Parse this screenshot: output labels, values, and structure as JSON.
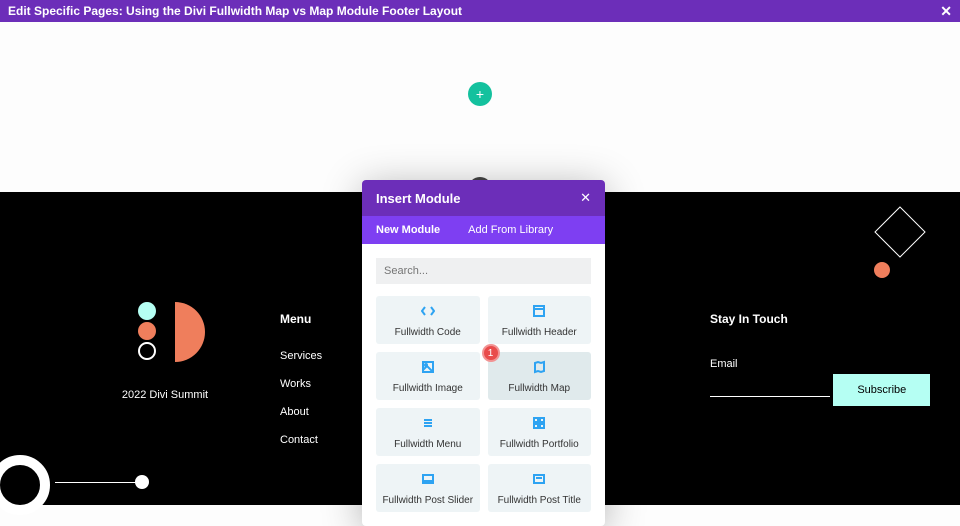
{
  "topbar": {
    "title": "Edit Specific Pages: Using the Divi Fullwidth Map vs Map Module Footer Layout"
  },
  "canvas": {
    "add_icon": "+",
    "add_icon2": "+"
  },
  "footer": {
    "brand_label": "2022 Divi Summit",
    "menu_title": "Menu",
    "menu_items": [
      "Services",
      "Works",
      "About",
      "Contact"
    ],
    "touch_title": "Stay In Touch",
    "email_label": "Email",
    "subscribe_label": "Subscribe"
  },
  "modal": {
    "title": "Insert Module",
    "tabs": {
      "new": "New Module",
      "library": "Add From Library"
    },
    "search_placeholder": "Search...",
    "modules": [
      {
        "name": "Fullwidth Code",
        "icon": "code"
      },
      {
        "name": "Fullwidth Header",
        "icon": "header"
      },
      {
        "name": "Fullwidth Image",
        "icon": "image"
      },
      {
        "name": "Fullwidth Map",
        "icon": "map",
        "highlight": true,
        "badge": "1"
      },
      {
        "name": "Fullwidth Menu",
        "icon": "menu"
      },
      {
        "name": "Fullwidth Portfolio",
        "icon": "portfolio"
      },
      {
        "name": "Fullwidth Post Slider",
        "icon": "slider"
      },
      {
        "name": "Fullwidth Post Title",
        "icon": "title"
      }
    ]
  }
}
